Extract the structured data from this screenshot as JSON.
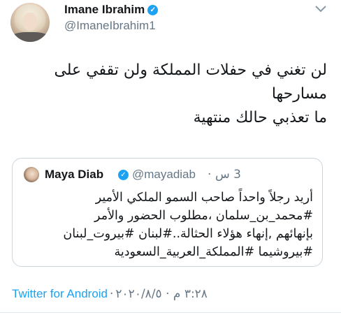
{
  "tweet": {
    "author_name": "Imane Ibrahim",
    "author_handle": "@ImaneIbrahim1",
    "lines": [
      "لن تغني في حفلات المملكة ولن تقفي على",
      "مسارحها",
      "ما تعذبي حالك منتهية"
    ],
    "icons": {
      "verified": "verified-badge-icon",
      "menu": "chevron-down-icon"
    }
  },
  "quoted": {
    "author_name": "Maya Diab",
    "author_handle": "@mayadiab",
    "separator": "·",
    "time": "3 س",
    "lines": [
      "أريد رجلاً واحداً صاحب السمو الملكي الأمير",
      "#محمد_بن_سلمان ،مطلوب الحضور والأمر",
      "بإنهائهم ,إنهاء هؤلاء الحثالة..#لبنان #بيروت_لبنان",
      "#بيروشيما #المملكة_العربية_السعودية"
    ]
  },
  "footer": {
    "source": "Twitter for Android",
    "separator": "·",
    "datetime": "٣:٢٨ م · ٢٠٢٠/٨/٥"
  },
  "colors": {
    "accent": "#1da1f2",
    "muted": "#657786",
    "text": "#14171a",
    "border": "#ccd6dd"
  }
}
